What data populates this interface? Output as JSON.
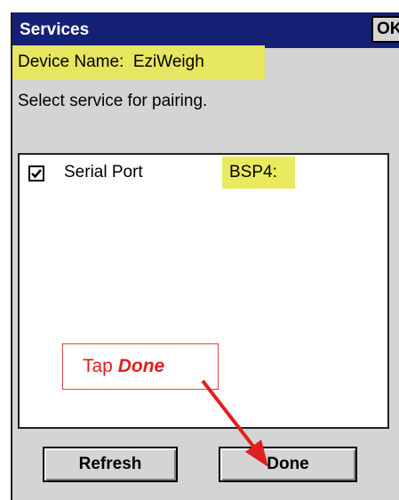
{
  "window": {
    "title": "Services",
    "ok_label": "OK"
  },
  "device": {
    "label": "Device Name:  EziWeigh"
  },
  "instruction": "Select service for pairing.",
  "services": [
    {
      "name": "Serial Port",
      "port": "BSP4:",
      "checked": true
    }
  ],
  "buttons": {
    "refresh": "Refresh",
    "done": "Done"
  },
  "callout": {
    "prefix": "Tap ",
    "emphasis": "Done"
  },
  "colors": {
    "titlebar": "#142073",
    "highlight": "#e6e660",
    "annotation": "#e02020"
  }
}
